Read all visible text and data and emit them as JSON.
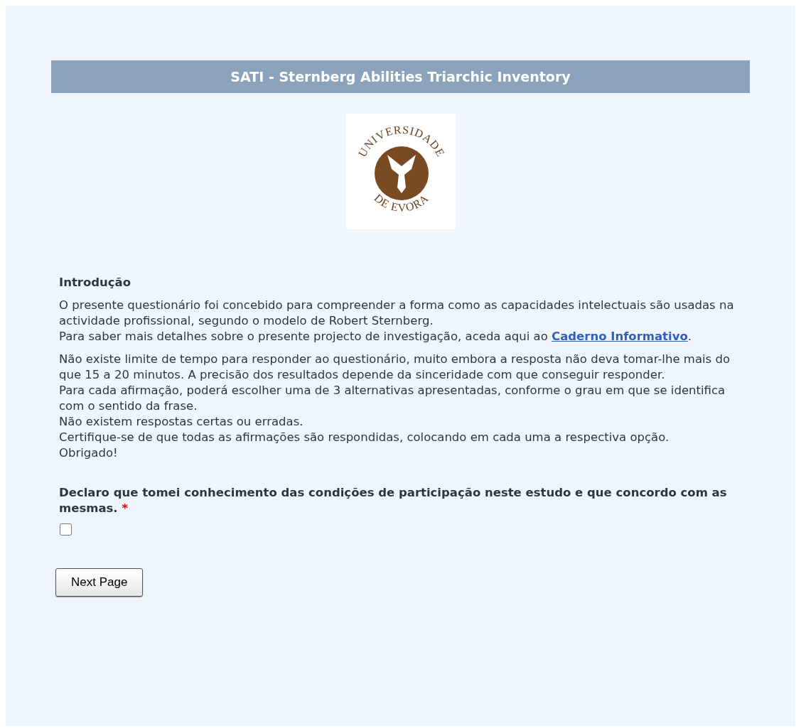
{
  "title": "SATI - Sternberg Abilities Triarchic Inventory",
  "logo": {
    "arc_top": "UNIVERSIDADE",
    "arc_bottom": "DE EVORA"
  },
  "intro": {
    "heading": "Introdução",
    "paragraphs": [
      [
        {
          "text": "O presente questionário foi concebido para compreender a forma como as capacidades intelectuais são usadas na actividade profissional, segundo o modelo de Robert Sternberg."
        },
        {
          "text": "Para saber mais detalhes sobre o presente projecto de investigação, aceda aqui ao ",
          "link": "Caderno Informativo",
          "after": "."
        }
      ],
      [
        {
          "text": "Não existe limite de tempo para responder ao questionário, muito embora a resposta não deva tomar-lhe mais do que 15 a 20 minutos. A precisão dos resultados depende da sinceridade com que conseguir responder."
        },
        {
          "text": "Para cada afirmação, poderá escolher uma de 3 alternativas apresentadas, conforme o grau em que se identifica com o sentido da frase."
        },
        {
          "text": "Não existem respostas certas ou erradas."
        },
        {
          "text": "Certifique-se de que todas as afirmações são respondidas, colocando em cada uma a respectiva opção."
        },
        {
          "text": "Obrigado!"
        }
      ]
    ]
  },
  "question": {
    "text": "Declaro que tomei conhecimento das condições de participação neste estudo e que concordo com as mesmas.",
    "required_mark": "*",
    "checked": false
  },
  "button": "Next Page"
}
